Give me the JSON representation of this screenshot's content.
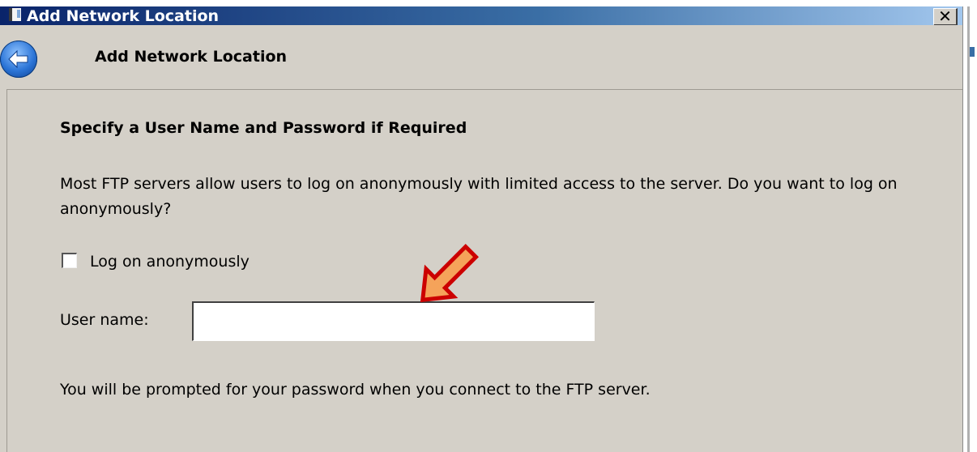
{
  "window": {
    "title": "Add Network Location",
    "close_label": "✕"
  },
  "wizard": {
    "title": "Add Network Location"
  },
  "page": {
    "heading": "Specify a User Name and Password if Required",
    "description": "Most FTP servers allow users to log on anonymously with limited access to the server.  Do you want to log on anonymously?",
    "anonymous_checkbox": {
      "label": "Log on anonymously",
      "checked": false
    },
    "username": {
      "label": "User name:",
      "value": "",
      "placeholder": ""
    },
    "password_note": "You will be prompted for your password when you connect to the FTP server."
  },
  "annotation": {
    "icon": "orange-arrow-pointer",
    "fill_color": "#f5a35a",
    "outline_color": "#cc0000"
  },
  "colors": {
    "dialog_background": "#d4d0c8",
    "titlebar_start": "#0a246a",
    "titlebar_end": "#a6caf0"
  }
}
